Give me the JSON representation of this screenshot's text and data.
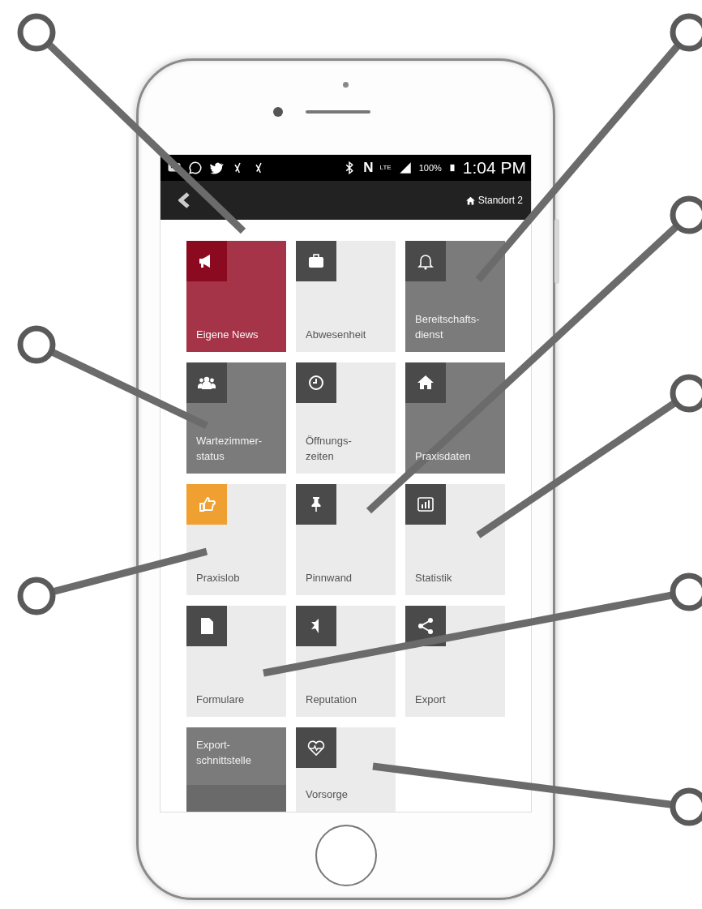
{
  "status_bar": {
    "nfc": "N",
    "network": "LTE",
    "battery": "100%",
    "time": "1:04 PM"
  },
  "app_bar": {
    "location": "Standort 2"
  },
  "tiles": [
    {
      "label": "Eigene News",
      "kind": "accent"
    },
    {
      "label": "Abwesenheit",
      "kind": "light"
    },
    {
      "label": "Bereitschafts-\ndienst",
      "kind": "dark"
    },
    {
      "label": "Wartezimmer-\nstatus",
      "kind": "dark"
    },
    {
      "label": "Öffnungs-\nzeiten",
      "kind": "light"
    },
    {
      "label": "Praxisdaten",
      "kind": "dark"
    },
    {
      "label": "Praxislob",
      "kind": "highlight"
    },
    {
      "label": "Pinnwand",
      "kind": "light"
    },
    {
      "label": "Statistik",
      "kind": "light"
    },
    {
      "label": "Formulare",
      "kind": "light"
    },
    {
      "label": "Reputation",
      "kind": "light"
    },
    {
      "label": "Export",
      "kind": "light"
    },
    {
      "label": "Export-\nschnittstelle",
      "kind": "banner"
    },
    {
      "label": "Vorsorge",
      "kind": "light"
    }
  ]
}
